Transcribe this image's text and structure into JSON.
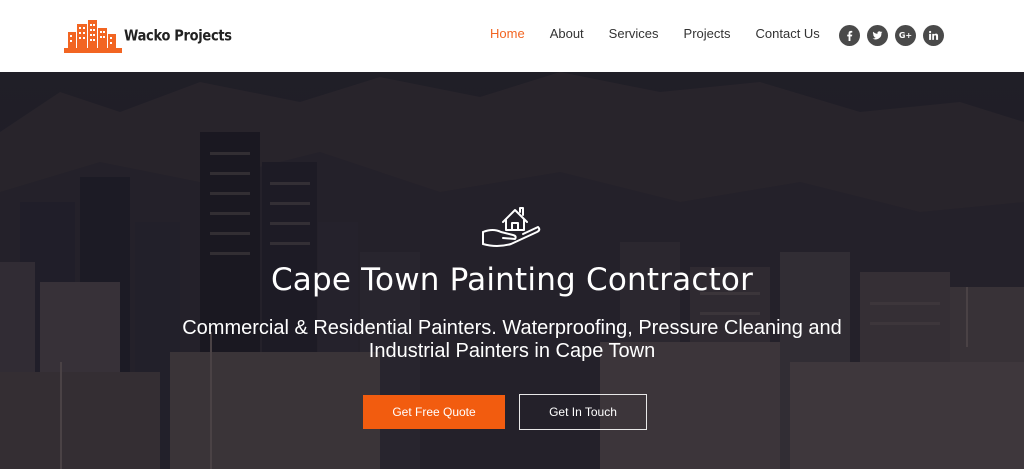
{
  "brand": {
    "name": "Wacko Projects",
    "accent_color": "#f26522"
  },
  "nav": {
    "items": [
      {
        "label": "Home",
        "active": true
      },
      {
        "label": "About",
        "active": false
      },
      {
        "label": "Services",
        "active": false
      },
      {
        "label": "Projects",
        "active": false
      },
      {
        "label": "Contact Us",
        "active": false
      }
    ]
  },
  "socials": [
    {
      "icon": "facebook-icon"
    },
    {
      "icon": "twitter-icon"
    },
    {
      "icon": "google-plus-icon",
      "text": "G+"
    },
    {
      "icon": "linkedin-icon"
    }
  ],
  "hero": {
    "icon": "house-in-hand-icon",
    "title": "Cape Town Painting Contractor",
    "subtitle": "Commercial & Residential Painters. Waterproofing, Pressure Cleaning and Industrial Painters in Cape Town",
    "primary_button": "Get Free Quote",
    "secondary_button": "Get In Touch",
    "primary_color": "#f25c0f"
  }
}
